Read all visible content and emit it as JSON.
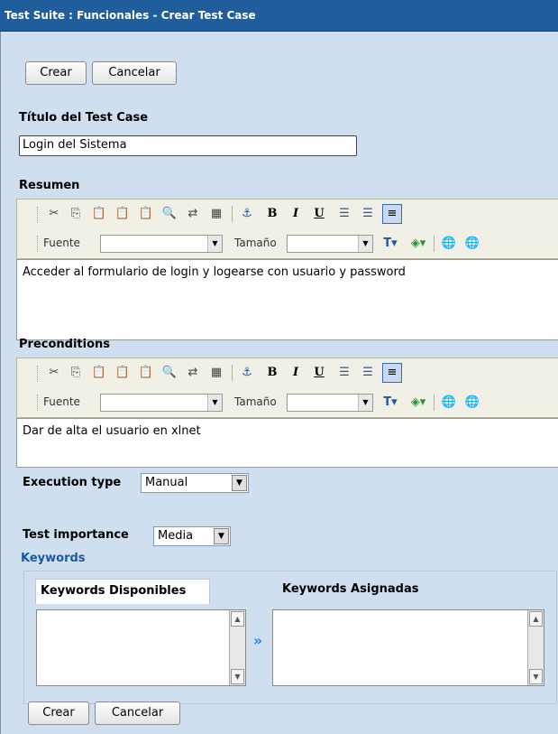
{
  "window": {
    "title": "Test Suite : Funcionales - Crear Test Case"
  },
  "buttons": {
    "create": "Crear",
    "cancel": "Cancelar"
  },
  "form": {
    "title_label": "Título del Test Case",
    "title_value": "Login del Sistema",
    "summary_label": "Resumen",
    "summary_text": "Acceder al formulario de login y logearse con usuario y password",
    "preconditions_label": "Preconditions",
    "preconditions_text": "Dar de alta el usuario en xlnet",
    "execution_type_label": "Execution type",
    "execution_type_value": "Manual",
    "importance_label": "Test importance",
    "importance_value": "Media"
  },
  "editor_toolbar": {
    "font_label": "Fuente",
    "size_label": "Tamaño",
    "icons": [
      "cut-icon",
      "copy-icon",
      "paste-icon",
      "paste-text-icon",
      "paste-word-icon",
      "find-icon",
      "replace-icon",
      "select-all-icon",
      "anchor-icon",
      "bold-icon",
      "italic-icon",
      "underline-icon",
      "ordered-list-icon",
      "unordered-list-icon",
      "justify-left-icon",
      "text-color-icon",
      "background-color-icon",
      "link-icon",
      "unlink-icon"
    ]
  },
  "keywords": {
    "section_label": "Keywords",
    "available_label": "Keywords Disponibles",
    "assigned_label": "Keywords Asignadas"
  },
  "colors": {
    "titlebar": "#1f5d9c",
    "panel": "#cfdff0",
    "keyword_label": "#1a5aa0"
  }
}
